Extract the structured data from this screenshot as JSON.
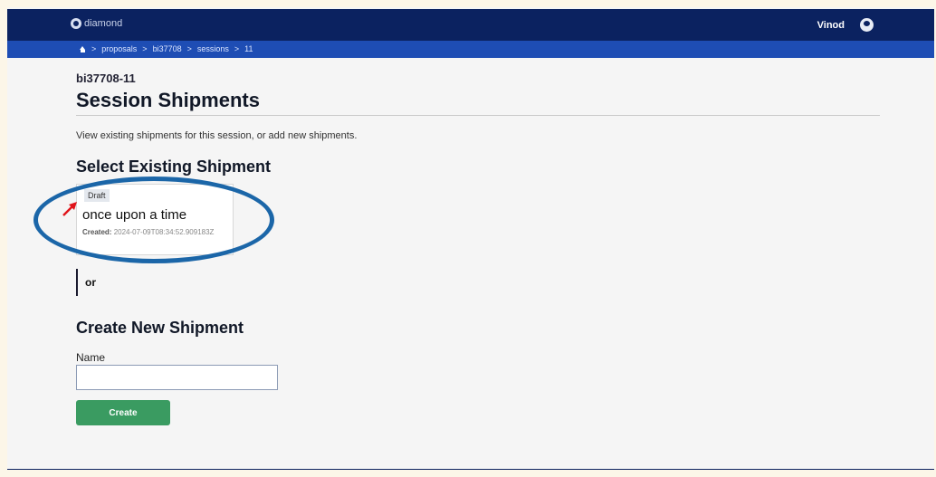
{
  "header": {
    "logo_text": "diamond",
    "user_name": "Vinod"
  },
  "breadcrumbs": [
    "proposals",
    ">",
    "bi37708",
    ">",
    "sessions",
    ">",
    "11"
  ],
  "breadcrumb_sep": ">",
  "page": {
    "session_id": "bi37708-11",
    "title": "Session Shipments",
    "description": "View existing shipments for this session, or add new shipments."
  },
  "existing": {
    "heading": "Select Existing Shipment",
    "shipments": [
      {
        "status": "Draft",
        "name": "once upon a time",
        "created_label": "Created:",
        "created_value": "2024-07-09T08:34:52.909183Z"
      }
    ]
  },
  "divider_text": "or",
  "create": {
    "heading": "Create New Shipment",
    "name_label": "Name",
    "name_value": "",
    "button_label": "Create"
  },
  "colors": {
    "topbar": "#0b2260",
    "breadcrumb_bar": "#1e4db4",
    "create_button": "#3a9b61",
    "annotation_ellipse": "#1b66a8",
    "annotation_arrow": "#e0141a"
  }
}
